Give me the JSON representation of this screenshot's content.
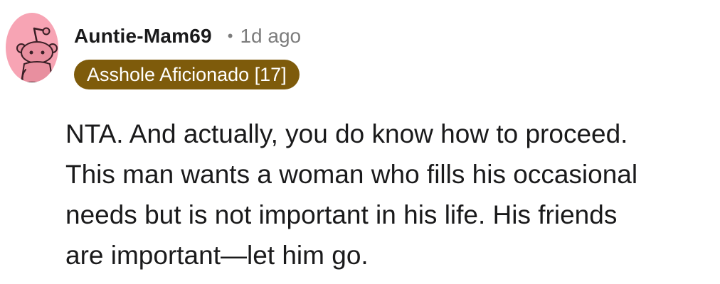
{
  "comment": {
    "author": "Auntie-Mam69",
    "separator": "•",
    "timestamp": "1d ago",
    "flair": "Asshole Aficionado [17]",
    "body_lines": [
      "NTA. And actually, you do know how to proceed.",
      "This man wants a woman who fills his occasional",
      "needs but is not important in his life. His friends",
      "are important—let him go."
    ]
  },
  "colors": {
    "avatar_background": "#f7a4b4",
    "flair_background": "#7e5b0b",
    "flair_text": "#ffffff",
    "muted_text": "#7c7c7c",
    "body_text": "#1a1a1b"
  },
  "icons": {
    "avatar": "snoo-avatar-icon"
  }
}
